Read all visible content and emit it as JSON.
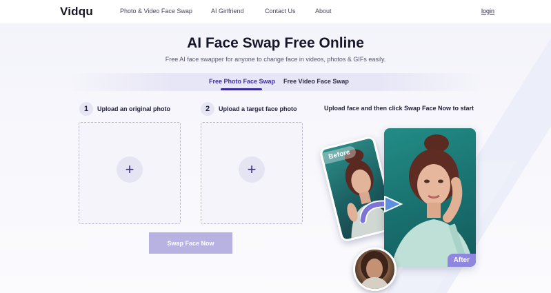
{
  "header": {
    "logo": "Vidqu",
    "nav": [
      {
        "label": "Photo & Video Face Swap"
      },
      {
        "label": "AI Girlfriend"
      },
      {
        "label": "Contact Us"
      },
      {
        "label": "About"
      }
    ],
    "login_label": "login"
  },
  "hero": {
    "title": "AI Face Swap Free Online",
    "subtitle": "Free AI face swapper for anyone to change face in videos, photos & GIFs easily.",
    "tabs": [
      {
        "label": "Free Photo Face Swap",
        "active": true
      },
      {
        "label": "Free Video Face Swap",
        "active": false
      }
    ]
  },
  "upload": {
    "steps": [
      {
        "number": "1",
        "label": "Upload an original photo"
      },
      {
        "number": "2",
        "label": "Upload a target face photo"
      }
    ],
    "plus_glyph": "+",
    "swap_button": "Swap Face Now"
  },
  "showcase": {
    "hint": "Upload face and then click Swap Face Now to start",
    "before_label": "Before",
    "after_label": "After"
  },
  "colors": {
    "accent": "#3a2e9c",
    "button_disabled": "#b8b2e2",
    "after_badge": "#8f86e0",
    "teal_background": "#1f7f7b"
  },
  "icons": [
    "plus-icon",
    "swap-arrow-icon"
  ]
}
